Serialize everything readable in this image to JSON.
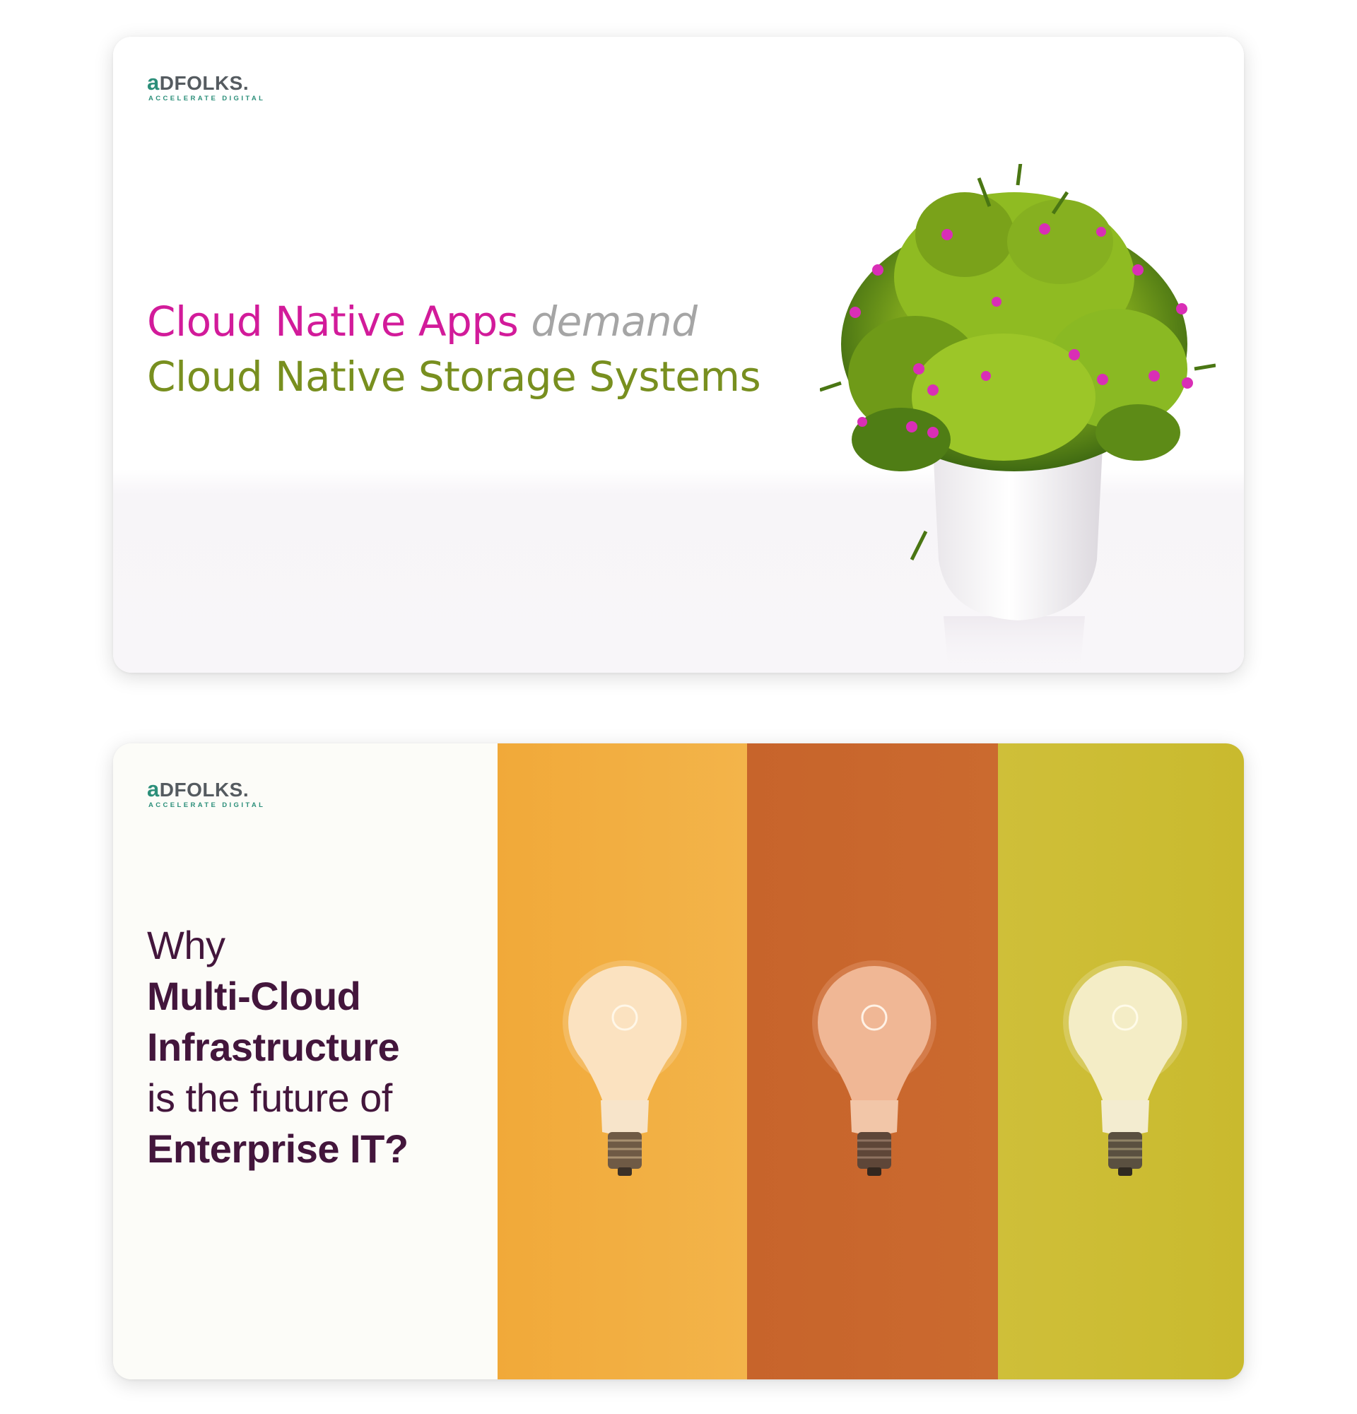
{
  "brand": {
    "logo_a": "a",
    "logo_rest": "DFOLKS.",
    "tagline": "ACCELERATE DIGITAL",
    "colors": {
      "teal": "#2c8f7a",
      "grey": "#555b60"
    }
  },
  "card1": {
    "headline_line1_part1": "Cloud Native Apps",
    "headline_line1_part2": "demand",
    "headline_line2": "Cloud Native Storage Systems",
    "colors": {
      "pink": "#d21b9a",
      "grey": "#a5a5a5",
      "olive": "#788f1f"
    },
    "image": "potted-plant-with-pink-flowers"
  },
  "card2": {
    "line1": "Why",
    "line2": "Multi-Cloud",
    "line3": "Infrastructure",
    "line4": "is the future of",
    "line5": "Enterprise IT?",
    "text_color": "#43163c",
    "panels": [
      {
        "color": "#f2ae40",
        "image": "light-bulb"
      },
      {
        "color": "#c9672d",
        "image": "light-bulb"
      },
      {
        "color": "#cdbd34",
        "image": "light-bulb"
      }
    ]
  }
}
